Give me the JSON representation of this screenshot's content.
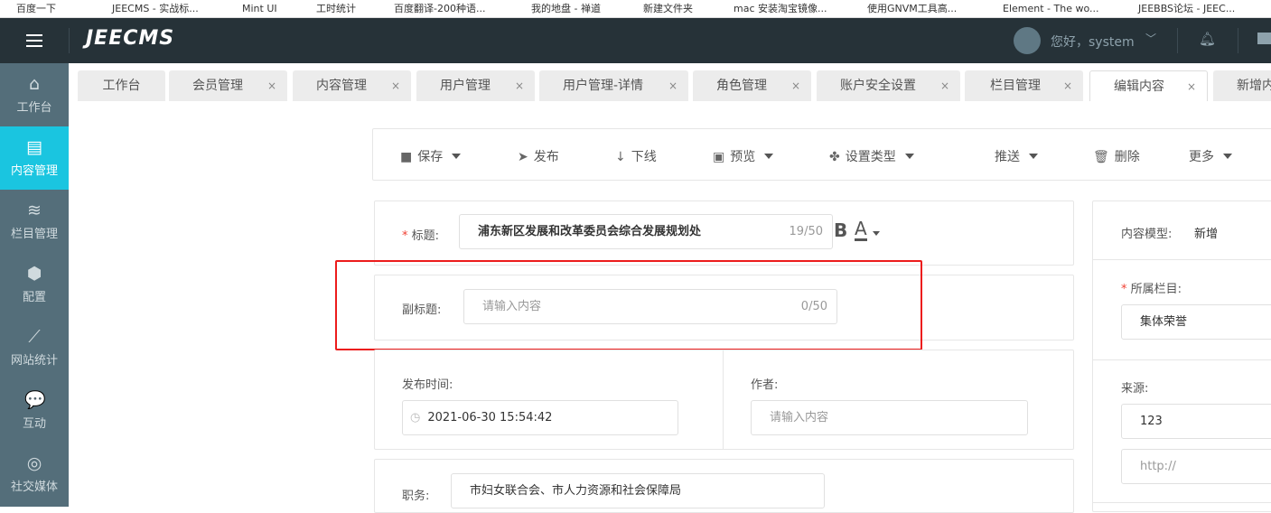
{
  "bookmarks": [
    "百度一下",
    "JEECMS - 实战标...",
    "Mint UI",
    "工时统计",
    "百度翻译-200种语...",
    "我的地盘 - 禅道",
    "新建文件夹",
    "mac 安装淘宝镜像...",
    "使用GNVM工具高...",
    "Element - The wo...",
    "JEEBBS论坛 - JEEC..."
  ],
  "header": {
    "logo": "JEECMS",
    "greeting": "您好，system"
  },
  "sidebar": [
    {
      "label": "工作台",
      "icon": "⌂"
    },
    {
      "label": "内容管理",
      "icon": "▤"
    },
    {
      "label": "栏目管理",
      "icon": "≋"
    },
    {
      "label": "配置",
      "icon": "⬢"
    },
    {
      "label": "网站统计",
      "icon": "⟋"
    },
    {
      "label": "互动",
      "icon": "💬"
    },
    {
      "label": "社交媒体",
      "icon": "◎"
    }
  ],
  "tabs": [
    "工作台",
    "会员管理",
    "内容管理",
    "用户管理",
    "用户管理-详情",
    "角色管理",
    "账户安全设置",
    "栏目管理",
    "编辑内容",
    "新增内"
  ],
  "toolbar": {
    "save": "保存",
    "publish": "发布",
    "offline": "下线",
    "preview": "预览",
    "set_type": "设置类型",
    "push": "推送",
    "delete": "删除",
    "more": "更多"
  },
  "form": {
    "title_label": "标题:",
    "title_value": "浦东新区发展和改革委员会综合发展规划处",
    "title_count": "19/50",
    "bold": "B",
    "color": "A",
    "subtitle_label": "副标题:",
    "subtitle_placeholder": "请输入内容",
    "subtitle_count": "0/50",
    "time_label": "发布时间:",
    "time_value": "2021-06-30 15:54:42",
    "author_label": "作者:",
    "author_placeholder": "请输入内容",
    "job_label": "职务:",
    "job_value": "市妇女联合会、市人力资源和社会保障局"
  },
  "right": {
    "model_label": "内容模型:",
    "model_value": "新增",
    "channel_label": "所属栏目:",
    "channel_value": "集体荣誉",
    "source_label": "来源:",
    "source_value": "123",
    "url_placeholder": "http://"
  },
  "colors": {
    "header": "#263238",
    "sidebar": "#546e7a",
    "active": "#1ac5e0",
    "highlight": "#ec1c1c"
  }
}
